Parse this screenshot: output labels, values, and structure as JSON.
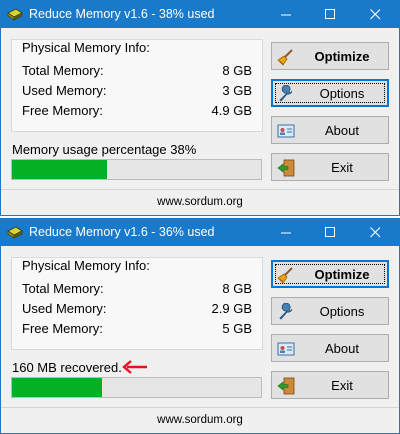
{
  "window1": {
    "title": "Reduce Memory v1.6 - 38% used",
    "info_title": "Physical Memory Info:",
    "rows": [
      {
        "label": "Total Memory:",
        "value": "8 GB"
      },
      {
        "label": "Used Memory:",
        "value": "3 GB"
      },
      {
        "label": "Free Memory:",
        "value": "4.9 GB"
      }
    ],
    "status": "Memory usage percentage 38%",
    "progress_fraction": 0.38,
    "buttons": {
      "optimize": "Optimize",
      "options": "Options",
      "about": "About",
      "exit": "Exit"
    },
    "footer": "www.sordum.org"
  },
  "window2": {
    "title": "Reduce Memory v1.6 - 36% used",
    "info_title": "Physical Memory Info:",
    "rows": [
      {
        "label": "Total Memory:",
        "value": "8 GB"
      },
      {
        "label": "Used Memory:",
        "value": "2.9 GB"
      },
      {
        "label": "Free Memory:",
        "value": "5 GB"
      }
    ],
    "status": "160 MB recovered.",
    "progress_fraction": 0.36,
    "buttons": {
      "optimize": "Optimize",
      "options": "Options",
      "about": "About",
      "exit": "Exit"
    },
    "footer": "www.sordum.org"
  },
  "colors": {
    "titlebar": "#1979ca",
    "progress_fill": "#06b025",
    "arrow": "#e81123"
  },
  "icons": [
    "app-chip-icon",
    "minimize-icon",
    "maximize-icon",
    "close-icon",
    "broom-icon",
    "wrench-icon",
    "id-card-icon",
    "exit-door-icon",
    "red-arrow-icon"
  ]
}
